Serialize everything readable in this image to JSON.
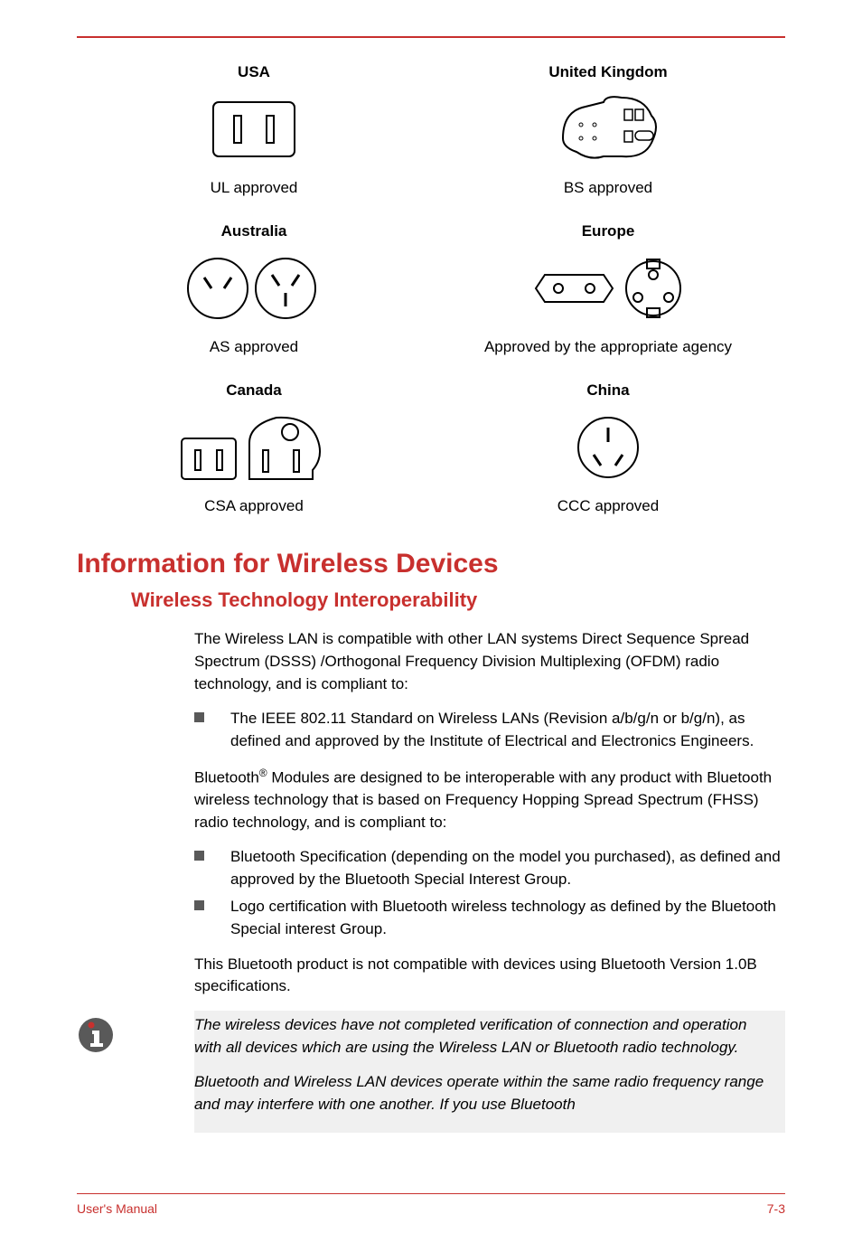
{
  "plugs": [
    {
      "region": "USA",
      "approval": "UL approved"
    },
    {
      "region": "United Kingdom",
      "approval": "BS approved"
    },
    {
      "region": "Australia",
      "approval": "AS approved"
    },
    {
      "region": "Europe",
      "approval": "Approved by the appropriate agency"
    },
    {
      "region": "Canada",
      "approval": "CSA approved"
    },
    {
      "region": "China",
      "approval": "CCC approved"
    }
  ],
  "section_title": "Information for Wireless Devices",
  "sub_title": "Wireless Technology Interoperability",
  "para1": "The Wireless LAN is compatible with other LAN systems Direct Sequence Spread Spectrum (DSSS) /Orthogonal Frequency Division Multiplexing (OFDM) radio technology, and is compliant to:",
  "bullets1": [
    "The IEEE 802.11 Standard on Wireless LANs (Revision a/b/g/n or b/g/n), as defined and approved by the Institute of Electrical and Electronics Engineers."
  ],
  "para2_pre": "Bluetooth",
  "para2_post": " Modules are designed to be interoperable with any product with Bluetooth wireless technology that is based on Frequency Hopping Spread Spectrum (FHSS) radio technology, and is compliant to:",
  "bullets2": [
    "Bluetooth Specification (depending on the model you purchased), as defined and approved by the Bluetooth Special Interest Group.",
    "Logo certification with Bluetooth wireless technology as defined by the Bluetooth Special interest Group."
  ],
  "para3": "This Bluetooth product is not compatible with devices using Bluetooth Version 1.0B specifications.",
  "note": {
    "p1": "The wireless devices have not completed verification of connection and operation with all devices which are using the Wireless LAN or Bluetooth radio technology.",
    "p2": "Bluetooth and Wireless LAN devices operate within the same radio frequency range and may interfere with one another. If you use Bluetooth"
  },
  "footer_left": "User's Manual",
  "footer_right": "7-3"
}
